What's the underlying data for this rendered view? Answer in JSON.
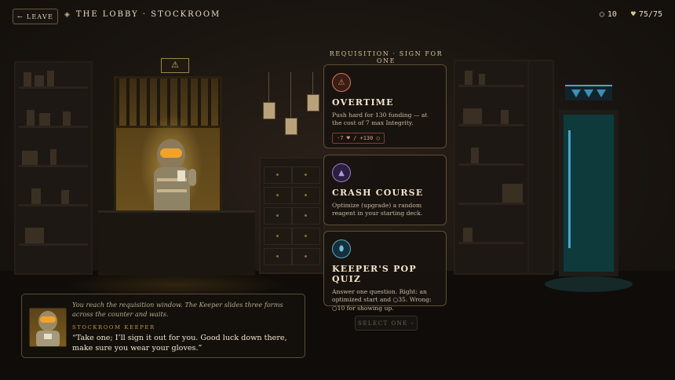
{
  "topbar": {
    "leave_label": "LEAVE",
    "location_title": "THE LOBBY · STOCKROOM",
    "funding": "10",
    "integrity": "75/75"
  },
  "sign_icon": "⚠",
  "requisition": {
    "heading": "REQUISITION · SIGN FOR ONE",
    "cards": [
      {
        "icon": "warning-triangle-icon",
        "glyph": "⚠",
        "accent": "#d17a5a",
        "title": "OVERTIME",
        "description": "Push hard for 130 funding — at the cost of 7 max Integrity.",
        "cost": "-7 ♥ / +130 ○"
      },
      {
        "icon": "triangle-reagent-icon",
        "glyph": "▲",
        "accent": "#9b7ad6",
        "title": "CRASH COURSE",
        "description": "Optimize (upgrade) a random reagent in your starting deck."
      },
      {
        "icon": "pill-icon",
        "glyph": "⬮",
        "accent": "#5aa8c8",
        "title": "KEEPER'S POP QUIZ",
        "description": "Answer one question. Right: an optimized start and ○35. Wrong: ○10 for showing up."
      }
    ],
    "select_label": "SELECT ONE ›"
  },
  "dialogue": {
    "narration": "You reach the requisition window. The Keeper slides three forms across the counter and waits.",
    "speaker": "STOCKROOM KEEPER",
    "line": "“Take one; I’ll sign it out for you. Good luck down there, make sure you wear your gloves.”"
  },
  "colors": {
    "background": "#14100c",
    "accent_gold": "#c79a45",
    "door_teal": "#0e3a3c"
  }
}
